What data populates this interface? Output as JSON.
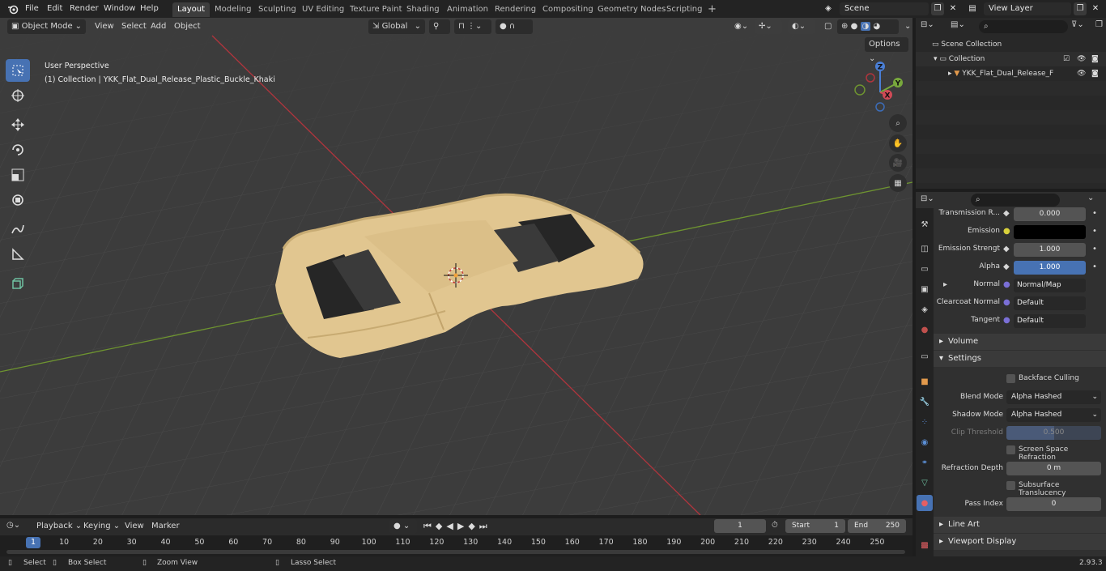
{
  "topbar": {
    "menus": [
      "File",
      "Edit",
      "Render",
      "Window",
      "Help"
    ],
    "workspaces": [
      "Layout",
      "Modeling",
      "Sculpting",
      "UV Editing",
      "Texture Paint",
      "Shading",
      "Animation",
      "Rendering",
      "Compositing",
      "Geometry Nodes",
      "Scripting"
    ],
    "active_workspace": "Layout",
    "scene": "Scene",
    "view_layer": "View Layer"
  },
  "viewport": {
    "mode": "Object Mode",
    "menus": [
      "View",
      "Select",
      "Add",
      "Object"
    ],
    "transform_orientation": "Global",
    "options_label": "Options",
    "overlay_title": "User Perspective",
    "overlay_subtitle": "(1) Collection | YKK_Flat_Dual_Release_Plastic_Buckle_Khaki",
    "gizmo": {
      "z": "Z",
      "y": "Y",
      "x": "X"
    },
    "object_color": "#e1c690"
  },
  "outliner": {
    "scene_collection": "Scene Collection",
    "collection": "Collection",
    "object": "YKK_Flat_Dual_Release_F"
  },
  "properties": {
    "transmission_label": "Transmission R...",
    "transmission_value": "0.000",
    "emission_label": "Emission",
    "emission_color": "#000000",
    "emission_strength_label": "Emission Strengt",
    "emission_strength_value": "1.000",
    "alpha_label": "Alpha",
    "alpha_value": "1.000",
    "normal_label": "Normal",
    "normal_value": "Normal/Map",
    "clearcoat_normal_label": "Clearcoat Normal",
    "clearcoat_normal_value": "Default",
    "tangent_label": "Tangent",
    "tangent_value": "Default",
    "volume_section": "Volume",
    "settings_section": "Settings",
    "backface_culling": "Backface Culling",
    "blend_mode_label": "Blend Mode",
    "blend_mode_value": "Alpha Hashed",
    "shadow_mode_label": "Shadow Mode",
    "shadow_mode_value": "Alpha Hashed",
    "clip_threshold_label": "Clip Threshold",
    "clip_threshold_value": "0.500",
    "screen_space_refraction": "Screen Space Refraction",
    "refraction_depth_label": "Refraction Depth",
    "refraction_depth_value": "0 m",
    "subsurface_translucency": "Subsurface Translucency",
    "pass_index_label": "Pass Index",
    "pass_index_value": "0",
    "line_art_section": "Line Art",
    "viewport_display_section": "Viewport Display"
  },
  "timeline": {
    "menus": [
      "Playback",
      "Keying",
      "View",
      "Marker"
    ],
    "current_frame": "1",
    "start_label": "Start",
    "start_value": "1",
    "end_label": "End",
    "end_value": "250",
    "ticks": [
      "1",
      "10",
      "20",
      "30",
      "40",
      "50",
      "60",
      "70",
      "80",
      "90",
      "100",
      "110",
      "120",
      "130",
      "140",
      "150",
      "160",
      "170",
      "180",
      "190",
      "200",
      "210",
      "220",
      "230",
      "240",
      "250"
    ]
  },
  "statusbar": {
    "select": "Select",
    "box_select": "Box Select",
    "zoom_view": "Zoom View",
    "lasso_select": "Lasso Select",
    "version": "2.93.3"
  }
}
